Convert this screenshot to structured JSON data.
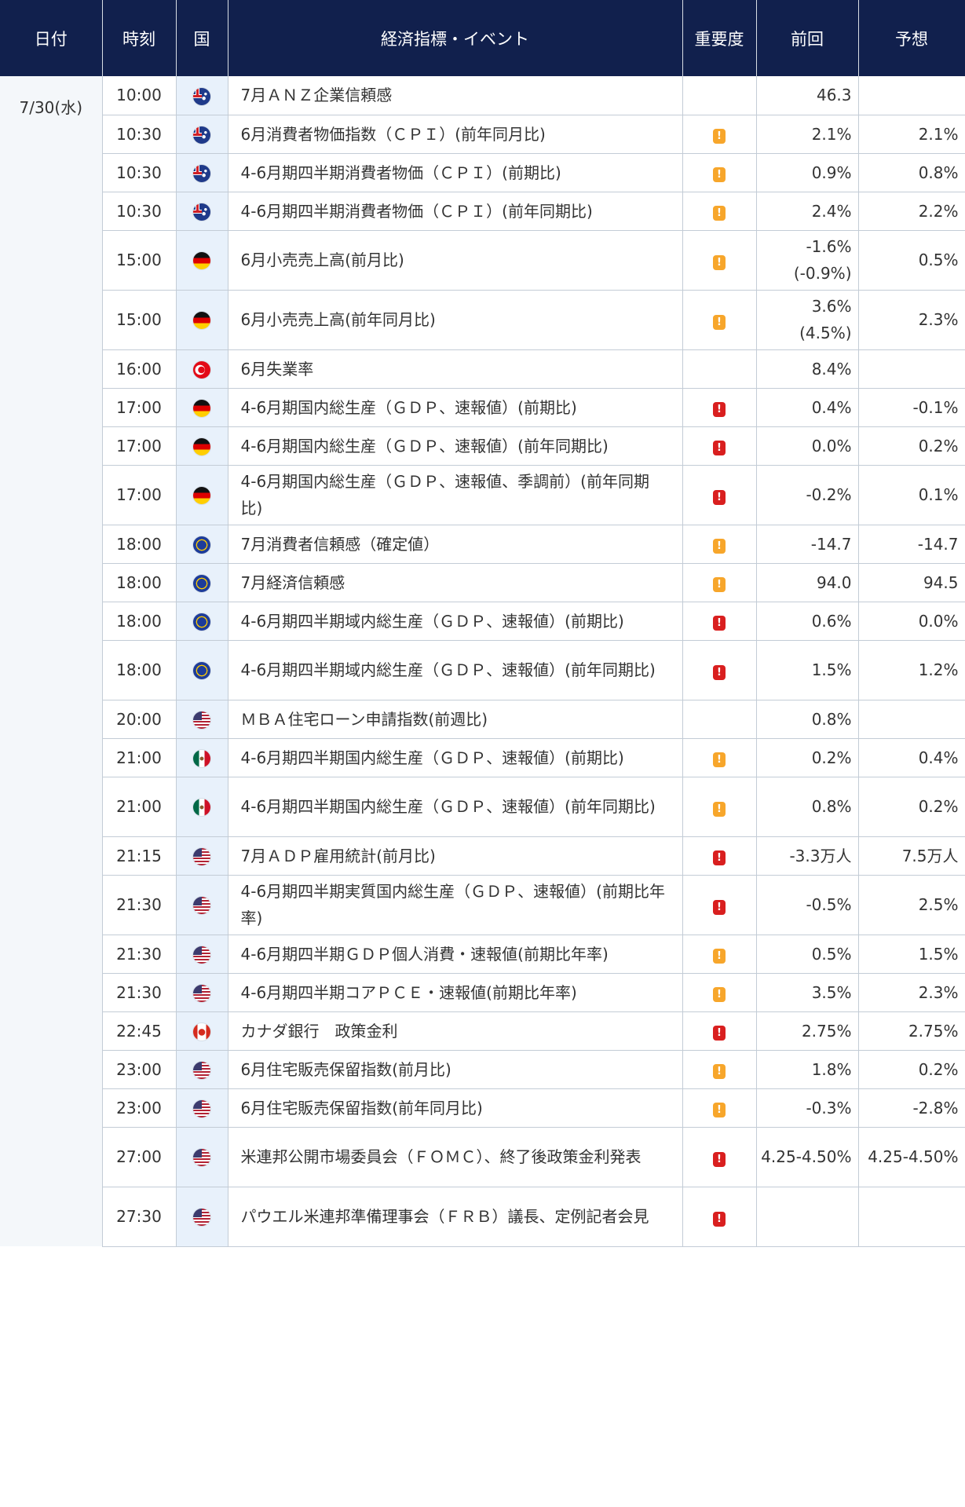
{
  "headers": {
    "date": "日付",
    "time": "時刻",
    "country": "国",
    "event": "経済指標・イベント",
    "importance": "重要度",
    "previous": "前回",
    "forecast": "予想"
  },
  "date": "7/30(水)",
  "rows": [
    {
      "time": "10:00",
      "flag": "au-flag-icon",
      "event": "7月ＡＮＺ企業信頼感",
      "importance": "",
      "previous": "46.3",
      "forecast": ""
    },
    {
      "time": "10:30",
      "flag": "au-flag-icon",
      "event": "6月消費者物価指数（ＣＰＩ）(前年同月比)",
      "importance": "medium",
      "previous": "2.1%",
      "forecast": "2.1%"
    },
    {
      "time": "10:30",
      "flag": "au-flag-icon",
      "event": "4-6月期四半期消費者物価（ＣＰＩ）(前期比)",
      "importance": "medium",
      "previous": "0.9%",
      "forecast": "0.8%"
    },
    {
      "time": "10:30",
      "flag": "au-flag-icon",
      "event": "4-6月期四半期消費者物価（ＣＰＩ）(前年同期比)",
      "importance": "medium",
      "previous": "2.4%",
      "forecast": "2.2%"
    },
    {
      "time": "15:00",
      "flag": "de-flag-icon",
      "event": "6月小売売上高(前月比)",
      "importance": "medium",
      "previous": "-1.6%",
      "previous2": "(-0.9%)",
      "forecast": "0.5%"
    },
    {
      "time": "15:00",
      "flag": "de-flag-icon",
      "event": "6月小売売上高(前年同月比)",
      "importance": "medium",
      "previous": "3.6%",
      "previous2": "(4.5%)",
      "forecast": "2.3%"
    },
    {
      "time": "16:00",
      "flag": "tr-flag-icon",
      "event": "6月失業率",
      "importance": "",
      "previous": "8.4%",
      "forecast": ""
    },
    {
      "time": "17:00",
      "flag": "de-flag-icon",
      "event": "4-6月期国内総生産（ＧＤＰ、速報値）(前期比)",
      "importance": "high",
      "previous": "0.4%",
      "forecast": "-0.1%"
    },
    {
      "time": "17:00",
      "flag": "de-flag-icon",
      "event": "4-6月期国内総生産（ＧＤＰ、速報値）(前年同期比)",
      "importance": "high",
      "previous": "0.0%",
      "forecast": "0.2%"
    },
    {
      "time": "17:00",
      "flag": "de-flag-icon",
      "event": "4-6月期国内総生産（ＧＤＰ、速報値、季調前）(前年同期比)",
      "importance": "high",
      "previous": "-0.2%",
      "forecast": "0.1%"
    },
    {
      "time": "18:00",
      "flag": "eu-flag-icon",
      "event": "7月消費者信頼感（確定値）",
      "importance": "medium",
      "previous": "-14.7",
      "forecast": "-14.7"
    },
    {
      "time": "18:00",
      "flag": "eu-flag-icon",
      "event": "7月経済信頼感",
      "importance": "medium",
      "previous": "94.0",
      "forecast": "94.5"
    },
    {
      "time": "18:00",
      "flag": "eu-flag-icon",
      "event": "4-6月期四半期域内総生産（ＧＤＰ、速報値）(前期比)",
      "importance": "high",
      "previous": "0.6%",
      "forecast": "0.0%"
    },
    {
      "time": "18:00",
      "flag": "eu-flag-icon",
      "event": "4-6月期四半期域内総生産（ＧＤＰ、速報値）(前年同期比)",
      "importance": "high",
      "previous": "1.5%",
      "forecast": "1.2%"
    },
    {
      "time": "20:00",
      "flag": "us-flag-icon",
      "event": "ＭＢＡ住宅ローン申請指数(前週比)",
      "importance": "",
      "previous": "0.8%",
      "forecast": ""
    },
    {
      "time": "21:00",
      "flag": "mx-flag-icon",
      "event": "4-6月期四半期国内総生産（ＧＤＰ、速報値）(前期比)",
      "importance": "medium",
      "previous": "0.2%",
      "forecast": "0.4%"
    },
    {
      "time": "21:00",
      "flag": "mx-flag-icon",
      "event": "4-6月期四半期国内総生産（ＧＤＰ、速報値）(前年同期比)",
      "importance": "medium",
      "previous": "0.8%",
      "forecast": "0.2%"
    },
    {
      "time": "21:15",
      "flag": "us-flag-icon",
      "event": "7月ＡＤＰ雇用統計(前月比)",
      "importance": "high",
      "previous": "-3.3万人",
      "forecast": "7.5万人"
    },
    {
      "time": "21:30",
      "flag": "us-flag-icon",
      "event": "4-6月期四半期実質国内総生産（ＧＤＰ、速報値）(前期比年率)",
      "importance": "high",
      "previous": "-0.5%",
      "forecast": "2.5%"
    },
    {
      "time": "21:30",
      "flag": "us-flag-icon",
      "event": "4-6月期四半期ＧＤＰ個人消費・速報値(前期比年率)",
      "importance": "medium",
      "previous": "0.5%",
      "forecast": "1.5%"
    },
    {
      "time": "21:30",
      "flag": "us-flag-icon",
      "event": "4-6月期四半期コアＰＣＥ・速報値(前期比年率)",
      "importance": "medium",
      "previous": "3.5%",
      "forecast": "2.3%"
    },
    {
      "time": "22:45",
      "flag": "ca-flag-icon",
      "event": "カナダ銀行　政策金利",
      "importance": "high",
      "previous": "2.75%",
      "forecast": "2.75%"
    },
    {
      "time": "23:00",
      "flag": "us-flag-icon",
      "event": "6月住宅販売保留指数(前月比)",
      "importance": "medium",
      "previous": "1.8%",
      "forecast": "0.2%"
    },
    {
      "time": "23:00",
      "flag": "us-flag-icon",
      "event": "6月住宅販売保留指数(前年同月比)",
      "importance": "medium",
      "previous": "-0.3%",
      "forecast": "-2.8%"
    },
    {
      "time": "27:00",
      "flag": "us-flag-icon",
      "event": "米連邦公開市場委員会（ＦＯＭＣ）、終了後政策金利発表",
      "importance": "high",
      "previous": "4.25-4.50%",
      "forecast": "4.25-4.50%"
    },
    {
      "time": "27:30",
      "flag": "us-flag-icon",
      "event": "パウエル米連邦準備理事会（ＦＲＢ）議長、定例記者会見",
      "importance": "high",
      "previous": "",
      "forecast": ""
    }
  ],
  "importance_colors": {
    "high": "#d91f1f",
    "medium": "#f7a62b"
  },
  "header_bg": "#11204d"
}
